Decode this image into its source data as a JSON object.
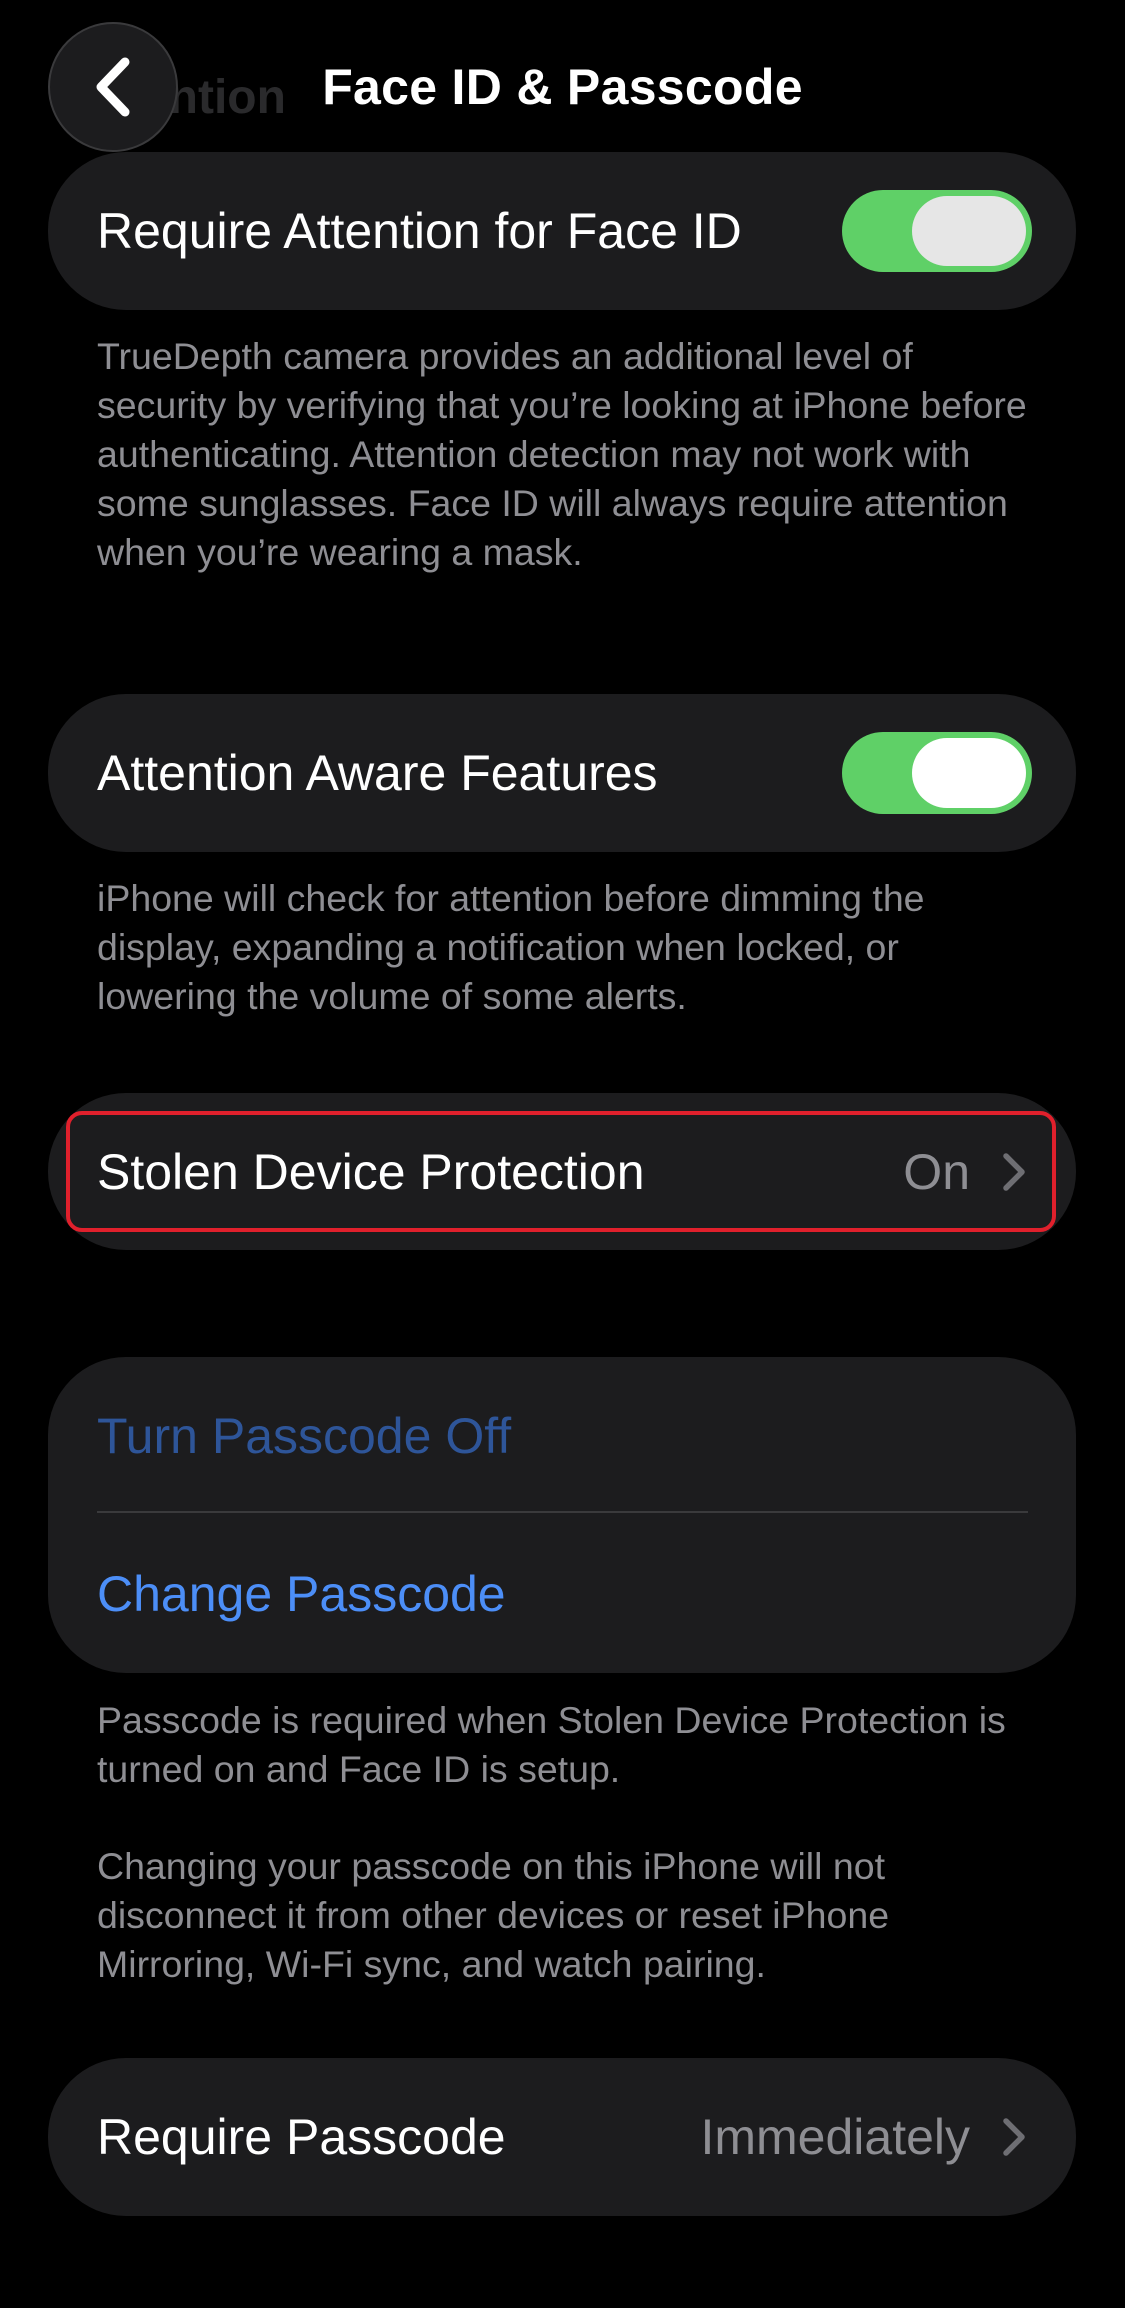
{
  "header": {
    "title": "Face ID & Passcode",
    "ghost_text": "ttention"
  },
  "attention_card": {
    "label": "Require Attention for Face ID",
    "toggle_on": true
  },
  "attention_footnote": "TrueDepth camera provides an additional level of security by verifying that you’re looking at iPhone before authenticating. Attention detection may not work with some sunglasses. Face ID will always require attention when you’re wearing a mask.",
  "aware_card": {
    "label": "Attention Aware Features",
    "toggle_on": true
  },
  "aware_footnote": "iPhone will check for attention before dimming the display, expanding a notification when locked, or lowering the volume of some alerts.",
  "stolen_card": {
    "label": "Stolen Device Protection",
    "value": "On"
  },
  "passcode_card": {
    "turn_off_label": "Turn Passcode Off",
    "change_label": "Change Passcode"
  },
  "passcode_footnote_1": "Passcode is required when Stolen Device Protection is turned on and Face ID is setup.",
  "passcode_footnote_2": "Changing your passcode on this iPhone will not disconnect it from other devices or reset iPhone Mirroring, Wi-Fi sync, and watch pairing.",
  "require_card": {
    "label": "Require Passcode",
    "value": "Immediately"
  },
  "colors": {
    "background": "#000000",
    "card": "#1c1c1e",
    "toggle_on": "#5fd067",
    "link_blue": "#4c8ef7",
    "secondary_text": "#8e8e93",
    "highlight_red": "#e0202c"
  }
}
